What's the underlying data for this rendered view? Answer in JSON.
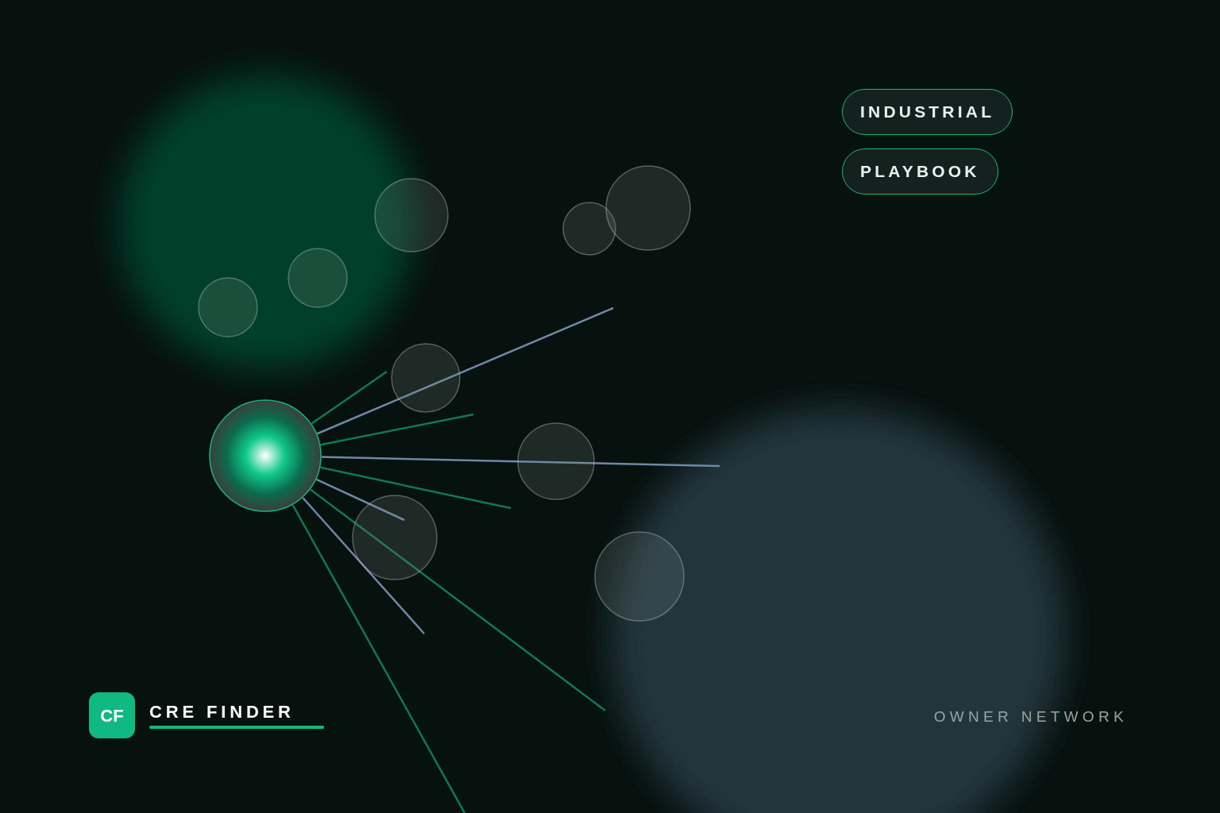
{
  "tags": [
    {
      "label": "INDUSTRIAL"
    },
    {
      "label": "PLAYBOOK"
    }
  ],
  "logo": {
    "mark": "CF",
    "name": "CRE FINDER"
  },
  "caption": "OWNER NETWORK"
}
